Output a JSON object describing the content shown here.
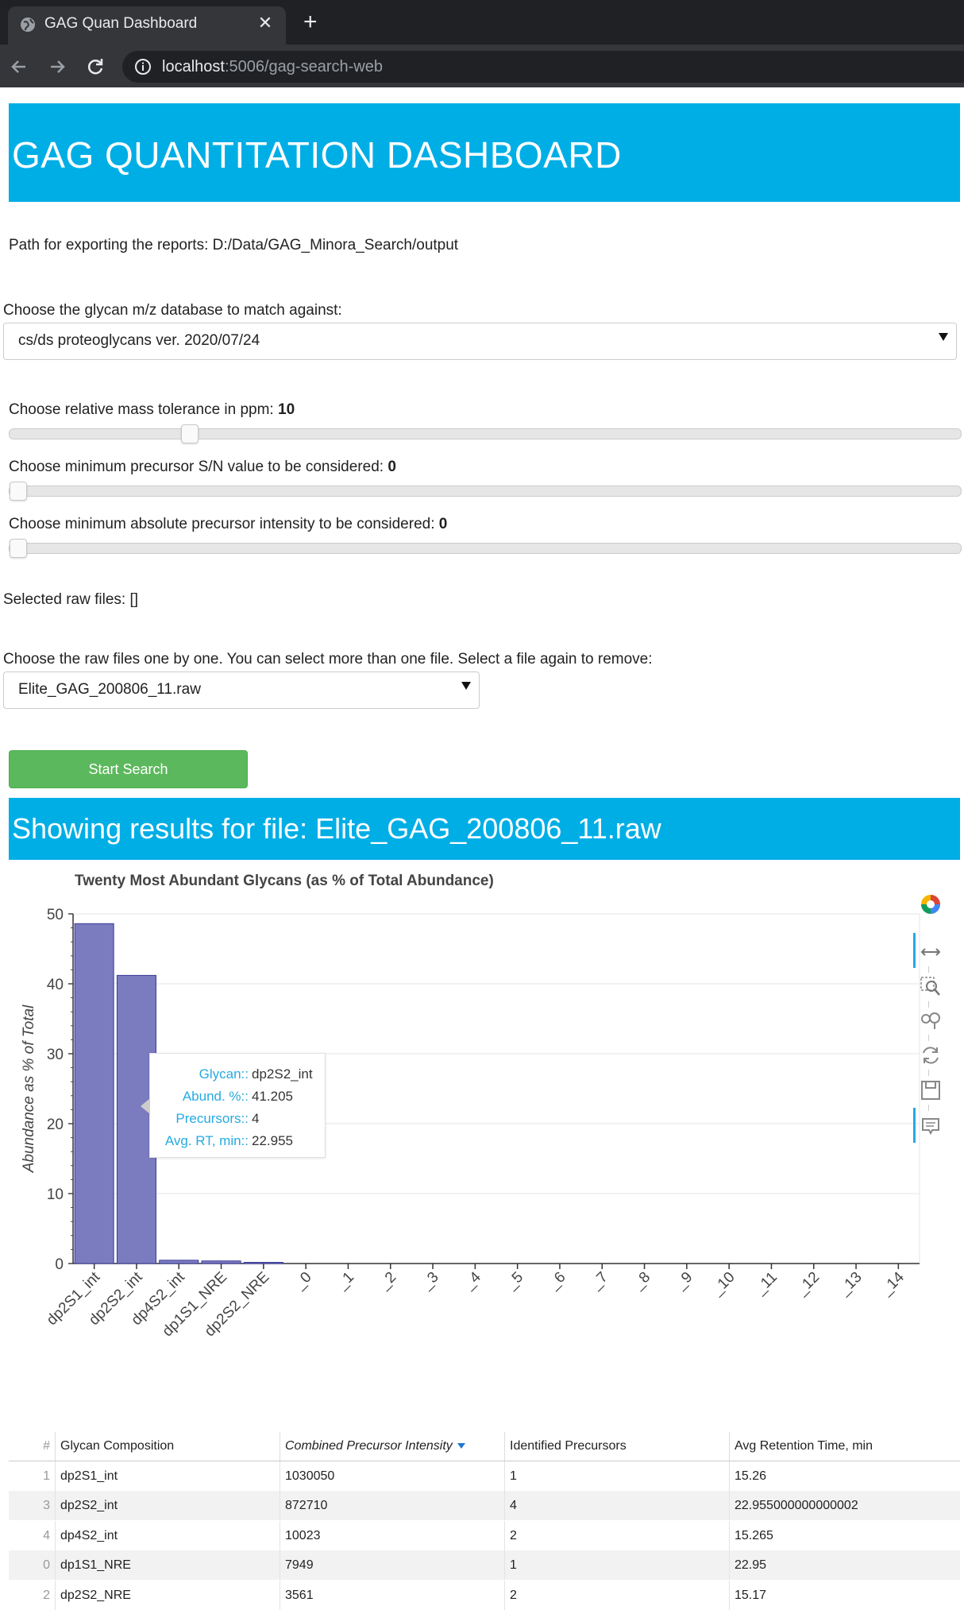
{
  "browser": {
    "tab_title": "GAG Quan Dashboard",
    "url_host": "localhost",
    "url_path": ":5006/gag-search-web"
  },
  "header": {
    "title": "GAG QUANTITATION DASHBOARD"
  },
  "export_path_text": "Path for exporting the reports: D:/Data/GAG_Minora_Search/output",
  "database": {
    "label": "Choose the glycan m/z database to match against:",
    "selected": "cs/ds proteoglycans ver. 2020/07/24"
  },
  "sliders": [
    {
      "label": "Choose relative mass tolerance in ppm: ",
      "value": "10",
      "fraction": 0.184
    },
    {
      "label": "Choose minimum precursor S/N value to be considered: ",
      "value": "0",
      "fraction": 0.0
    },
    {
      "label": "Choose minimum absolute precursor intensity to be considered: ",
      "value": "0",
      "fraction": 0.0
    }
  ],
  "selected_files_text": "Selected raw files: []",
  "raw_files": {
    "label": "Choose the raw files one by one. You can select more than one file. Select a file again to remove:",
    "selected": "Elite_GAG_200806_11.raw"
  },
  "start_button": "Start Search",
  "results_title": "Showing results for file: Elite_GAG_200806_11.raw",
  "chart_data": {
    "type": "bar",
    "title": "Twenty Most Abundant Glycans (as % of Total Abundance)",
    "ylabel": "Abundance as % of Total",
    "xlabel": "",
    "categories": [
      "dp2S1_int",
      "dp2S2_int",
      "dp4S2_int",
      "dp1S1_NRE",
      "dp2S2_NRE",
      "_0",
      "_1",
      "_2",
      "_3",
      "_4",
      "_5",
      "_6",
      "_7",
      "_8",
      "_9",
      "_10",
      "_11",
      "_12",
      "_13",
      "_14"
    ],
    "values": [
      48.6,
      41.205,
      0.47,
      0.37,
      0.17,
      0,
      0,
      0,
      0,
      0,
      0,
      0,
      0,
      0,
      0,
      0,
      0,
      0,
      0,
      0
    ],
    "ylim": [
      0,
      50
    ],
    "yticks": [
      0,
      10,
      20,
      30,
      40,
      50
    ],
    "grid": true,
    "bar_color": "#7b7bc0",
    "bar_edge": "#3b3b99"
  },
  "tooltip": {
    "rows": [
      {
        "label": "Glycan::",
        "value": "dp2S2_int"
      },
      {
        "label": "Abund. %::",
        "value": "41.205"
      },
      {
        "label": "Precursors::",
        "value": "4"
      },
      {
        "label": "Avg. RT, min::",
        "value": "22.955"
      }
    ]
  },
  "tools": [
    "color-wheel-icon",
    "pan-icon",
    "box-zoom-icon",
    "wheel-zoom-icon",
    "reset-icon",
    "save-icon",
    "hover-icon"
  ],
  "table": {
    "headers": [
      "#",
      "Glycan Composition",
      "Combined Precursor Intensity",
      "Identified Precursors",
      "Avg Retention Time, min"
    ],
    "rows": [
      [
        "1",
        "dp2S1_int",
        "1030050",
        "1",
        "15.26"
      ],
      [
        "3",
        "dp2S2_int",
        "872710",
        "4",
        "22.955000000000002"
      ],
      [
        "4",
        "dp4S2_int",
        "10023",
        "2",
        "15.265"
      ],
      [
        "0",
        "dp1S1_NRE",
        "7949",
        "1",
        "22.95"
      ],
      [
        "2",
        "dp2S2_NRE",
        "3561",
        "2",
        "15.17"
      ]
    ]
  }
}
